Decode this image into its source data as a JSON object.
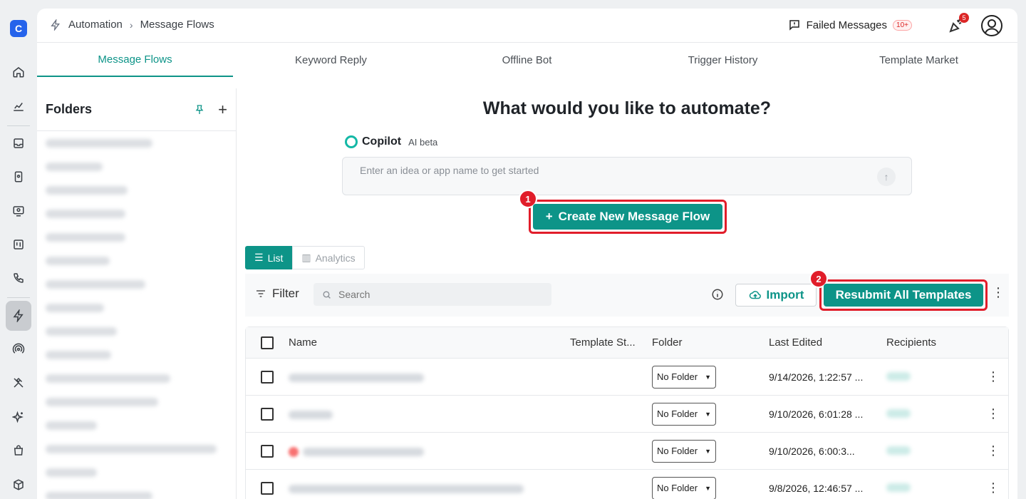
{
  "app": {
    "logo_letter": "C",
    "breadcrumb": [
      "Automation",
      "Message Flows"
    ],
    "failed_label": "Failed Messages",
    "failed_badge": "10+",
    "notif_badge": "5"
  },
  "tabs": [
    {
      "label": "Message Flows",
      "active": true
    },
    {
      "label": "Keyword Reply",
      "active": false
    },
    {
      "label": "Offline Bot",
      "active": false
    },
    {
      "label": "Trigger History",
      "active": false
    },
    {
      "label": "Template Market",
      "active": false
    }
  ],
  "folders": {
    "title": "Folders",
    "plus": "+"
  },
  "main": {
    "headline": "What would you like to automate?",
    "copilot_name": "Copilot",
    "copilot_beta": "AI beta",
    "idea_placeholder": "Enter an idea or app name to get started",
    "create_label": "Create New Message Flow",
    "create_plus": "+",
    "step1": "1",
    "step2": "2",
    "view_list": "List",
    "view_analytics": "Analytics"
  },
  "toolbar": {
    "filter_label": "Filter",
    "search_placeholder": "Search",
    "import_label": "Import",
    "resubmit_label": "Resubmit All Templates"
  },
  "table": {
    "columns": [
      "Name",
      "Template St...",
      "Folder",
      "Last Edited",
      "Recipients"
    ],
    "rows": [
      {
        "folder": "No Folder",
        "last_edited": "9/14/2026, 1:22:57 ..."
      },
      {
        "folder": "No Folder",
        "last_edited": "9/10/2026, 6:01:28 ..."
      },
      {
        "folder": "No Folder",
        "last_edited": "9/10/2026, 6:00:3..."
      },
      {
        "folder": "No Folder",
        "last_edited": "9/8/2026, 12:46:57 ..."
      }
    ]
  },
  "colors": {
    "accent": "#0d9488",
    "highlight": "#e11d2a",
    "brand": "#2563eb"
  }
}
